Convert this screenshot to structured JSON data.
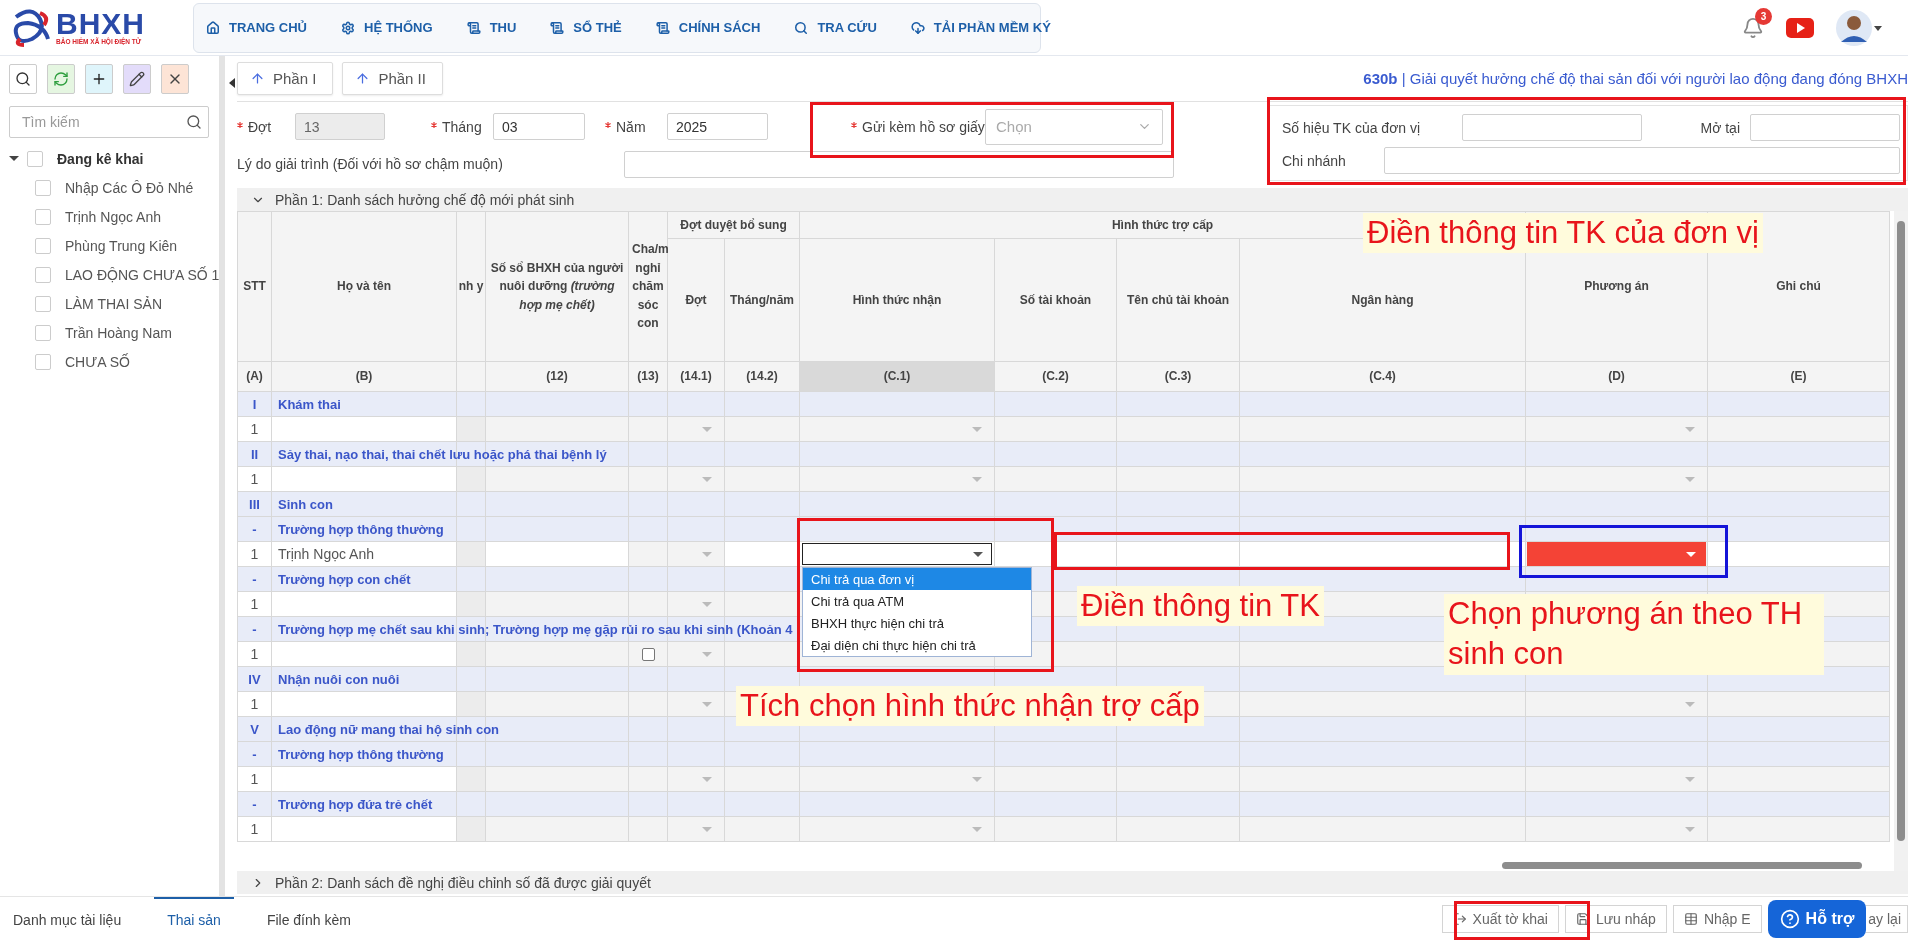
{
  "header": {
    "logo": {
      "name": "BHXH",
      "tagline": "BẢO HIỂM XÃ HỘI ĐIỆN TỬ"
    },
    "nav": [
      {
        "label": "TRANG CHỦ"
      },
      {
        "label": "HỆ THỐNG"
      },
      {
        "label": "THU"
      },
      {
        "label": "SỔ THẺ"
      },
      {
        "label": "CHÍNH SÁCH"
      },
      {
        "label": "TRA CỨU"
      },
      {
        "label": "TẢI PHẦN MỀM KÝ"
      }
    ],
    "notifications": "3"
  },
  "sidebar": {
    "tools": [
      {
        "kind": "search"
      },
      {
        "kind": "refresh"
      },
      {
        "kind": "add"
      },
      {
        "kind": "edit"
      },
      {
        "kind": "delete"
      }
    ],
    "search": {
      "placeholder": "Tìm kiếm"
    },
    "tree": [
      {
        "label": "Đang kê khai",
        "expanded": true,
        "checked": false,
        "children": [
          {
            "label": "Nhập Các Ô Đỏ Nhé",
            "checked": false
          },
          {
            "label": "Trịnh Ngọc Anh",
            "checked": false
          },
          {
            "label": "Phùng Trung Kiên",
            "checked": false
          },
          {
            "label": "LAO ĐỘNG CHƯA SỐ 1",
            "checked": false
          },
          {
            "label": "LÀM THAI SẢN",
            "checked": false
          },
          {
            "label": "Trần Hoàng Nam",
            "checked": false
          },
          {
            "label": "CHƯA SỐ",
            "checked": false
          }
        ]
      }
    ]
  },
  "part_buttons": [
    "Phần I",
    "Phần II"
  ],
  "form_title": "**630b** | Giải quyết hưởng chế độ thai sản đối với người lao động đang đóng BHXH",
  "fields": [
    {
      "kind": "input",
      "label": "Đợt",
      "value": "13",
      "required": true,
      "disabled": true
    },
    {
      "kind": "input",
      "label": "Tháng",
      "value": "03",
      "required": true,
      "disabled": false
    },
    {
      "kind": "input",
      "label": "Năm",
      "value": "2025",
      "required": true,
      "disabled": false
    },
    {
      "kind": "select",
      "label": "Gửi kèm hồ sơ giấy",
      "placeholder": "Chọn",
      "required": true,
      "disabled": false
    }
  ],
  "reason": {
    "label": "Lý do giải trình (Đối với hồ sơ chậm muộn)"
  },
  "account": [
    {
      "label": "Số hiệu TK của đơn vị"
    },
    {
      "label": "Mở tại"
    },
    {
      "label": "Chi nhánh"
    }
  ],
  "section_1": {
    "label": "Phần 1: Danh sách hưởng chế độ mới phát sinh",
    "expanded": true
  },
  "table": {
    "column_groups": [
      {
        "label": "Đợt duyệt bổ sung"
      },
      {
        "label": "Hình thức trợ cấp"
      }
    ],
    "columns": [
      {
        "label": "STT",
        "code": "(A)",
        "selected": false
      },
      {
        "label": "Họ và tên",
        "code": "(B)",
        "selected": false
      },
      {
        "label": "nh y",
        "selected": false
      },
      {
        "label": "Số sổ BHXH của người nuôi dưỡng *(trường hợp mẹ chết)*",
        "code": "(12)",
        "selected": false
      },
      {
        "label": "Cha/m nghỉ chăm sóc con",
        "code": "(13)",
        "selected": false
      },
      {
        "label": "Đợt",
        "code": "(14.1)",
        "selected": false
      },
      {
        "label": "Tháng/năm",
        "code": "(14.2)",
        "selected": false
      },
      {
        "label": "Hình thức nhận",
        "code": "(C.1)",
        "selected": true
      },
      {
        "label": "Số tài khoản",
        "code": "(C.2)",
        "selected": false
      },
      {
        "label": "Tên chủ tài khoản",
        "code": "(C.3)",
        "selected": false
      },
      {
        "label": "Ngân hàng",
        "code": "(C.4)",
        "selected": false
      },
      {
        "label": "Phương án",
        "code": "(D)",
        "selected": false
      },
      {
        "label": "Ghi chú",
        "code": "(E)",
        "selected": false
      }
    ],
    "rows": [
      {
        "kind": "group",
        "number": "I",
        "title": "Khám thai"
      },
      {
        "kind": "data",
        "number": "1",
        "active": false
      },
      {
        "kind": "group",
        "number": "II",
        "title": "Sảy thai, nạo thai, thai chết lưu hoặc phá thai bệnh lý"
      },
      {
        "kind": "data",
        "number": "1",
        "active": false
      },
      {
        "kind": "group",
        "number": "III",
        "title": "Sinh con"
      },
      {
        "kind": "group",
        "number": "-",
        "title": "Trường hợp thông thường"
      },
      {
        "kind": "data",
        "number": "1",
        "name": "Trịnh Ngọc Anh",
        "active": true,
        "payment_options": [
          {
            "label": "Chi trả qua đơn vị",
            "selected": true
          },
          {
            "label": "Chi trả qua ATM",
            "selected": false
          },
          {
            "label": "BHXH thực hiện chi trả",
            "selected": false
          },
          {
            "label": "Đại diện chi thực hiện chi trả",
            "selected": false
          }
        ]
      },
      {
        "kind": "group",
        "number": "-",
        "title": "Trường hợp con chết"
      },
      {
        "kind": "data",
        "number": "1",
        "active": false
      },
      {
        "kind": "group",
        "number": "-",
        "title": "Trường hợp mẹ chết sau khi sinh; Trường hợp mẹ gặp rủi ro sau khi sinh (Khoản 4"
      },
      {
        "kind": "data",
        "number": "1",
        "active": false,
        "checked": false
      },
      {
        "kind": "group",
        "number": "IV",
        "title": "Nhận nuôi con nuôi"
      },
      {
        "kind": "data",
        "number": "1",
        "active": false
      },
      {
        "kind": "group",
        "number": "V",
        "title": "Lao động nữ mang thai hộ sinh con"
      },
      {
        "kind": "group",
        "number": "-",
        "title": "Trường hợp thông thường"
      },
      {
        "kind": "data",
        "number": "1",
        "active": false
      },
      {
        "kind": "group",
        "number": "-",
        "title": "Trường hợp đứa trẻ chết"
      },
      {
        "kind": "data",
        "number": "1",
        "active": false
      }
    ]
  },
  "section_2": {
    "label": "Phần 2: Danh sách đề nghị điều chỉnh số đã được giải quyết",
    "expanded": false
  },
  "footer": {
    "tabs": [
      {
        "label": "Danh mục tài liệu",
        "selected": false
      },
      {
        "label": "Thai sản",
        "selected": true
      },
      {
        "label": "File đính kèm",
        "selected": false
      }
    ],
    "actions": [
      {
        "kind": "export",
        "label": "Xuất tờ khai"
      },
      {
        "kind": "save",
        "label": "Lưu nháp"
      },
      {
        "kind": "import",
        "label": "Nhập E"
      },
      {
        "kind": "back",
        "label": "ay lại"
      }
    ],
    "help": "Hỗ trợ"
  },
  "annotations": [
    {
      "kind": "frame",
      "color": "#e8141b"
    },
    {
      "kind": "frame",
      "color": "#e8141b"
    },
    {
      "kind": "frame",
      "color": "#e8141b"
    },
    {
      "kind": "frame",
      "color": "#e8141b"
    },
    {
      "kind": "frame",
      "color": "#1414d8"
    },
    {
      "kind": "frame",
      "color": "#e8141b"
    },
    {
      "kind": "note",
      "text": "Điền thông tin TK của đơn vị"
    },
    {
      "kind": "note",
      "text": "Điền thông tin TK"
    },
    {
      "kind": "note",
      "text": "Chọn phương án theo TH sinh con"
    },
    {
      "kind": "note",
      "text": "Tích chọn hình thức nhận trợ cấp"
    }
  ]
}
